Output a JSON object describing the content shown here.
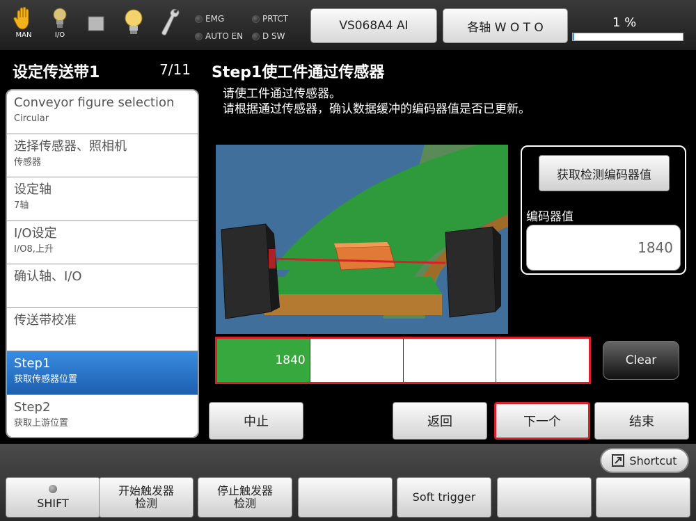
{
  "topbar": {
    "icons": [
      {
        "name": "hand-icon",
        "label": "MAN"
      },
      {
        "name": "lamp-icon",
        "label": "I/O"
      },
      {
        "name": "stop-square-icon",
        "label": ""
      },
      {
        "name": "lightbulb-icon",
        "label": ""
      },
      {
        "name": "wrench-icon",
        "label": ""
      }
    ],
    "status": {
      "emg": "EMG",
      "prtct": "PRTCT",
      "auto_en": "AUTO EN",
      "d_sw": "D SW"
    },
    "program_button": "VS068A4 AI",
    "axis_button": "各轴  W O T O",
    "progress_label": "1 %",
    "progress_value": 1
  },
  "left": {
    "title": "设定传送带1",
    "page": "7/11",
    "steps": [
      {
        "title": "Conveyor figure selection",
        "sub": "Circular",
        "active": false
      },
      {
        "title": "选择传感器、照相机",
        "sub": "传感器",
        "active": false
      },
      {
        "title": "设定轴",
        "sub": "7轴",
        "active": false
      },
      {
        "title": "I/O设定",
        "sub": "I/O8,上升",
        "active": false
      },
      {
        "title": "确认轴、I/O",
        "sub": "",
        "active": false
      },
      {
        "title": "传送带校准",
        "sub": "",
        "active": false
      },
      {
        "title": "Step1",
        "sub": "获取传感器位置",
        "active": true
      },
      {
        "title": "Step2",
        "sub": "获取上游位置",
        "active": false
      }
    ]
  },
  "main": {
    "title": "Step1使工件通过传感器",
    "instruction_1": "请使工件通过传感器。",
    "instruction_2": "请根据通过传感器，确认数据缓冲的编码器值是否已更新。",
    "get_encoder_button": "获取检测编码器值",
    "encoder_label": "编码器值",
    "encoder_value": "1840",
    "buffer": [
      "1840",
      "",
      "",
      ""
    ],
    "clear_button": "Clear",
    "abort_button": "中止",
    "back_button": "返回",
    "next_button": "下一个",
    "finish_button": "结束"
  },
  "bottom": {
    "shortcut": "Shortcut",
    "shift": "SHIFT",
    "start_trigger_1": "开始触发器",
    "start_trigger_2": "检测",
    "stop_trigger_1": "停止触发器",
    "stop_trigger_2": "检测",
    "soft_trigger": "Soft trigger"
  },
  "colors": {
    "accent_blue": "#1c5fb0",
    "highlight_red": "#d8202a",
    "buffer_green": "#36a83e",
    "conveyor_green": "#2e9a3c",
    "workpiece_orange": "#e07a36"
  }
}
